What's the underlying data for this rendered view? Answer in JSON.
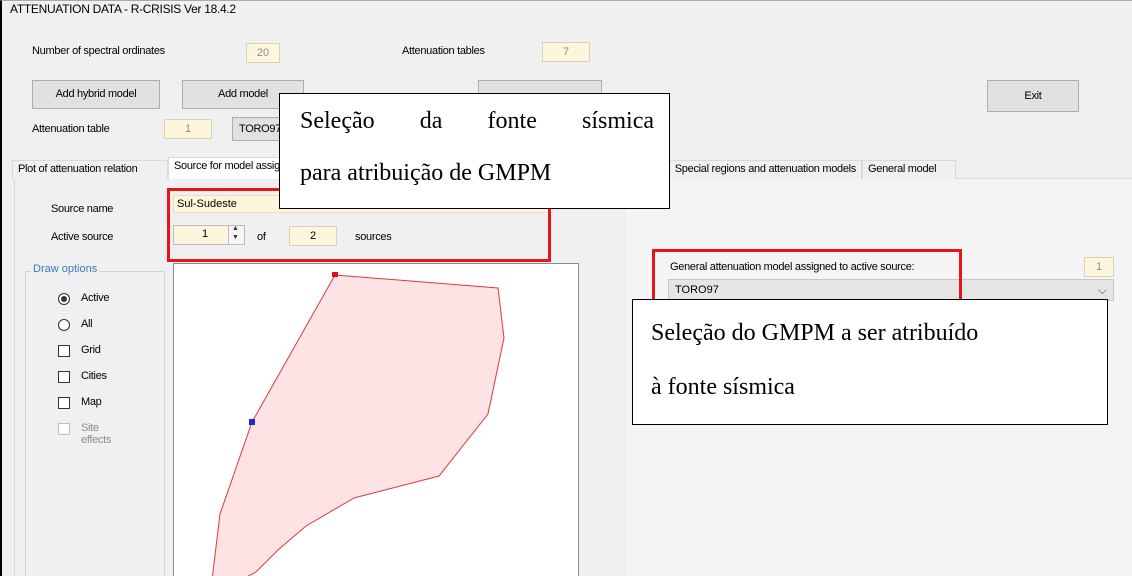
{
  "window": {
    "title": "ATTENUATION DATA - R-CRISIS Ver 18.4.2"
  },
  "header": {
    "spectral_label": "Number of spectral ordinates",
    "spectral_value": "20",
    "tables_label": "Attenuation tables",
    "tables_value": "7",
    "table_label": "Attenuation table",
    "table_value": "1",
    "table_name": "TORO97"
  },
  "toolbar": {
    "add_hybrid_label": "Add hybrid model",
    "add_model_label": "Add model",
    "exit_label": "Exit"
  },
  "tabs": [
    {
      "label": "Plot of attenuation relation"
    },
    {
      "label": "Source for model assignment"
    },
    {
      "label": "Special regions and attenuation models"
    },
    {
      "label": "General model"
    }
  ],
  "source": {
    "name_label": "Source name",
    "name_value": "Sul-Sudeste",
    "active_label": "Active source",
    "active_value": "1",
    "of_label": "of",
    "total_value": "2",
    "sources_label": "sources"
  },
  "draw_options": {
    "legend": "Draw options",
    "items": [
      {
        "label": "Active",
        "kind": "radio",
        "checked": true
      },
      {
        "label": "All",
        "kind": "radio",
        "checked": false
      },
      {
        "label": "Grid",
        "kind": "checkbox",
        "checked": false
      },
      {
        "label": "Cities",
        "kind": "checkbox",
        "checked": false
      },
      {
        "label": "Map",
        "kind": "checkbox",
        "checked": false
      },
      {
        "label": "Site effects",
        "kind": "checkbox",
        "checked": false,
        "disabled": true
      }
    ]
  },
  "general_model": {
    "assigned_label": "General attenuation model assigned to active source:",
    "assigned_index": "1",
    "selected_model": "TORO97"
  },
  "annotations": {
    "callout_source_line1": "Seleção da fonte sísmica",
    "callout_source_line2": "para atribuição de GMPM",
    "callout_model_line1": "Seleção do GMPM a ser atribuído",
    "callout_model_line2": "à fonte sísmica"
  },
  "colors": {
    "highlight_red": "#e8141a",
    "polygon_fill": "#fde3e3",
    "polygon_stroke": "#e0383e",
    "active_vertex": "#e0101a",
    "marker_vertex": "#1a2ad8"
  }
}
